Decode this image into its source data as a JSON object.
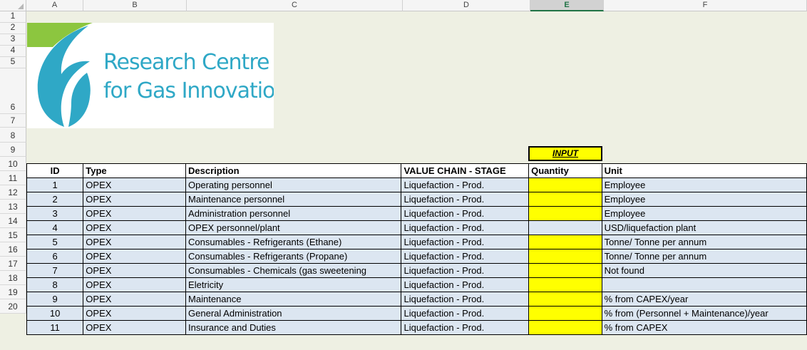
{
  "columns": [
    "A",
    "B",
    "C",
    "D",
    "E",
    "F"
  ],
  "selected_column": "E",
  "row_numbers": [
    "1",
    "2",
    "3",
    "4",
    "5",
    "6",
    "7",
    "8",
    "9",
    "10",
    "11",
    "12",
    "13",
    "14",
    "15",
    "16",
    "17",
    "18",
    "19",
    "20"
  ],
  "logo": {
    "line1": "Research Centre",
    "line2": "for Gas Innovation",
    "accent": "#2fa8c6",
    "leaf": "#8cc63f"
  },
  "input_label": "INPUT",
  "headers": {
    "id": "ID",
    "type": "Type",
    "description": "Description",
    "stage": "VALUE CHAIN - STAGE",
    "quantity": "Quantity",
    "unit": "Unit"
  },
  "rows": [
    {
      "id": "1",
      "type": "OPEX",
      "description": "Operating personnel",
      "stage": "Liquefaction - Prod.",
      "quantity": "",
      "unit": "Employee",
      "qty_highlight": true
    },
    {
      "id": "2",
      "type": "OPEX",
      "description": "Maintenance personnel",
      "stage": "Liquefaction - Prod.",
      "quantity": "",
      "unit": "Employee",
      "qty_highlight": true
    },
    {
      "id": "3",
      "type": "OPEX",
      "description": "Administration personnel",
      "stage": "Liquefaction - Prod.",
      "quantity": "",
      "unit": "Employee",
      "qty_highlight": true
    },
    {
      "id": "4",
      "type": "OPEX",
      "description": "OPEX personnel/plant",
      "stage": "Liquefaction - Prod.",
      "quantity": "",
      "unit": "USD/liquefaction plant",
      "qty_highlight": false
    },
    {
      "id": "5",
      "type": "OPEX",
      "description": "Consumables - Refrigerants (Ethane)",
      "stage": "Liquefaction - Prod.",
      "quantity": "",
      "unit": "Tonne/ Tonne per annum",
      "qty_highlight": true
    },
    {
      "id": "6",
      "type": "OPEX",
      "description": "Consumables - Refrigerants (Propane)",
      "stage": "Liquefaction - Prod.",
      "quantity": "",
      "unit": "Tonne/ Tonne per annum",
      "qty_highlight": true
    },
    {
      "id": "7",
      "type": "OPEX",
      "description": "Consumables - Chemicals (gas sweetening",
      "stage": "Liquefaction - Prod.",
      "quantity": "",
      "unit": "Not found",
      "qty_highlight": true
    },
    {
      "id": "8",
      "type": "OPEX",
      "description": "Eletricity",
      "stage": "Liquefaction - Prod.",
      "quantity": "",
      "unit": "",
      "qty_highlight": true
    },
    {
      "id": "9",
      "type": "OPEX",
      "description": "Maintenance",
      "stage": "Liquefaction - Prod.",
      "quantity": "",
      "unit": "% from CAPEX/year",
      "qty_highlight": true
    },
    {
      "id": "10",
      "type": "OPEX",
      "description": "General Administration",
      "stage": "Liquefaction - Prod.",
      "quantity": "",
      "unit": "% from (Personnel + Maintenance)/year",
      "qty_highlight": true
    },
    {
      "id": "11",
      "type": "OPEX",
      "description": "Insurance and Duties",
      "stage": "Liquefaction - Prod.",
      "quantity": "",
      "unit": "% from CAPEX",
      "qty_highlight": true
    }
  ]
}
